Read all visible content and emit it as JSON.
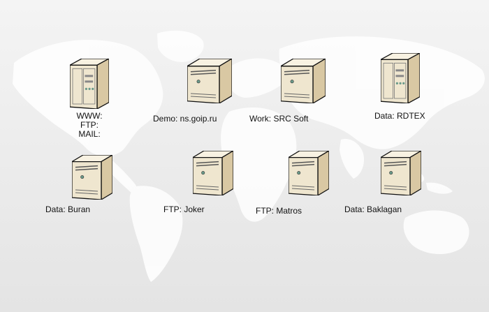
{
  "colors": {
    "background_top": "#f3f3f3",
    "background_bottom": "#e6e6e6",
    "map": "#ffffff",
    "server_front": "#efe6cf",
    "server_side": "#d9c8a3",
    "server_top": "#f8f2e2",
    "outline": "#111111"
  },
  "servers": [
    {
      "id": "www",
      "style": "tower",
      "label_lines": [
        "WWW:",
        "FTP:",
        "MAIL:"
      ]
    },
    {
      "id": "demo",
      "style": "cube",
      "label_lines": [
        "Demo: ns.goip.ru"
      ]
    },
    {
      "id": "work",
      "style": "cube",
      "label_lines": [
        "Work: SRC Soft"
      ]
    },
    {
      "id": "rdtex",
      "style": "tower",
      "label_lines": [
        "Data: RDTEX"
      ]
    },
    {
      "id": "buran",
      "style": "cube",
      "label_lines": [
        "Data: Buran"
      ]
    },
    {
      "id": "joker",
      "style": "cube",
      "label_lines": [
        "FTP: Joker"
      ]
    },
    {
      "id": "matros",
      "style": "cube",
      "label_lines": [
        "FTP: Matros"
      ]
    },
    {
      "id": "baklagan",
      "style": "cube",
      "label_lines": [
        "Data: Baklagan"
      ]
    }
  ]
}
